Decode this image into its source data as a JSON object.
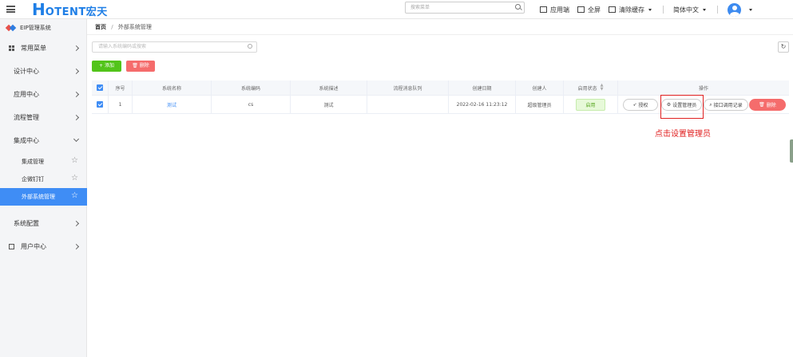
{
  "header": {
    "logo_initial": "H",
    "logo_text": "OTENT宏天",
    "search_placeholder": "搜索菜单",
    "actions": [
      "应用端",
      "全屏",
      "清除缓存"
    ],
    "language": "简体中文"
  },
  "sidebar": {
    "brand": "EIP管理系统",
    "items": [
      {
        "label": "常用菜单"
      },
      {
        "label": "设计中心"
      },
      {
        "label": "应用中心"
      },
      {
        "label": "流程管理"
      },
      {
        "label": "集成中心"
      },
      {
        "label": "系统配置"
      },
      {
        "label": "用户中心"
      }
    ],
    "sub_items": [
      {
        "label": "集成管理"
      },
      {
        "label": "企微钉钉"
      },
      {
        "label": "外部系统管理",
        "active": true
      }
    ]
  },
  "breadcrumb": {
    "home": "首页",
    "separator": "/",
    "current": "外部系统管理"
  },
  "toolbar": {
    "search_placeholder": "请输入系统编码或搜索",
    "add_label": "+ 添加",
    "delete_label": "🗑 删除"
  },
  "table": {
    "columns": [
      "序号",
      "系统名称",
      "系统编码",
      "系统描述",
      "流程消息队列",
      "创建日期",
      "创建人",
      "启用状态",
      "操作"
    ],
    "rows": [
      {
        "index": "1",
        "name": "测试",
        "code": "cs",
        "description": "测试",
        "queue": "",
        "created": "2022-02-16 11:23:12",
        "creator": "超级管理员",
        "status": "启用",
        "ops": [
          "授权",
          "设置管理员",
          "接口调用记录",
          "删除"
        ]
      }
    ]
  },
  "annotation": "点击设置管理员",
  "colors": {
    "primary": "#3f8df5",
    "success": "#52c41a",
    "danger": "#f56c6c",
    "highlight": "#e02020"
  }
}
